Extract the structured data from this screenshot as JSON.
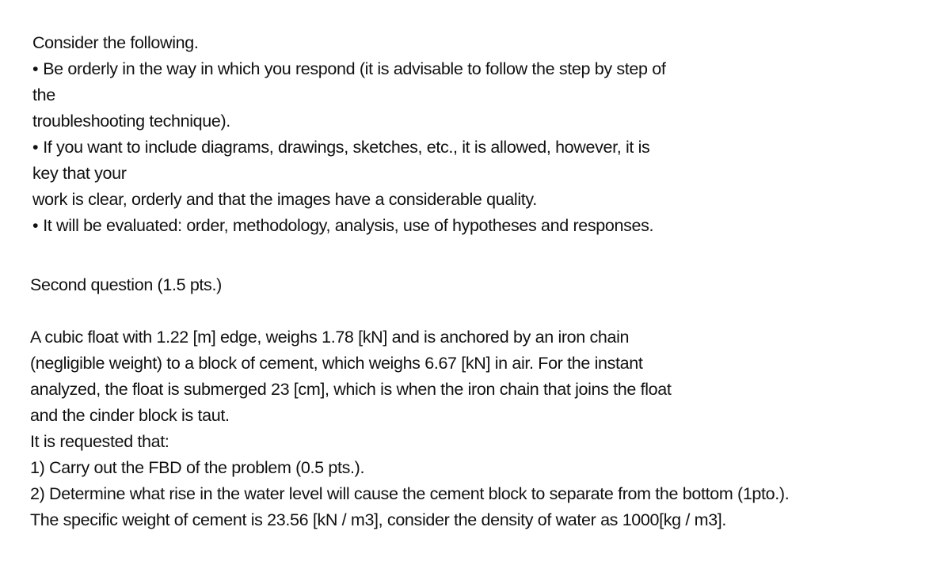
{
  "instructions": {
    "heading": "Consider the following.",
    "bullet_glyph": "•",
    "lines": [
      "Be orderly in the way in which you respond (it is advisable to follow the step by step of",
      "the",
      "troubleshooting technique).",
      "If you want to include diagrams, drawings, sketches, etc., it is allowed, however, it is",
      "key that your",
      "work is clear, orderly and that the images have a considerable quality.",
      "It will be evaluated: order, methodology, analysis, use of hypotheses and responses."
    ]
  },
  "question": {
    "title": "Second question (1.5 pts.)",
    "statement": [
      "A cubic float with 1.22 [m] edge, weighs 1.78 [kN] and is anchored by an iron chain",
      "(negligible weight) to a block of cement, which weighs 6.67 [kN] in air. For the instant",
      "analyzed, the float is submerged 23 [cm], which is when the iron chain that joins the float",
      "and the cinder block is taut."
    ],
    "request_intro": "It is requested that:",
    "tasks": [
      "1) Carry out the FBD of the problem (0.5 pts.).",
      "2) Determine what rise in the water level will cause the cement block to separate from the bottom (1pto.)."
    ],
    "given_data": "The specific weight of cement is 23.56 [kN / m3], consider the density of water as 1000[kg / m3]."
  }
}
